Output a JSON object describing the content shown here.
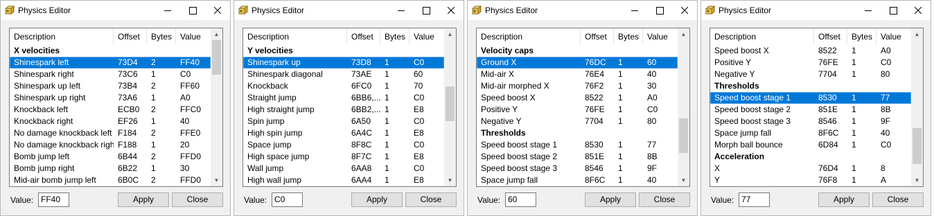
{
  "colors": {
    "selection": "#0078d7",
    "window_bg": "#f0f0f0",
    "list_bg": "#ffffff"
  },
  "windows": [
    {
      "title": "Physics Editor",
      "columns": [
        "Description",
        "Offset",
        "Bytes",
        "Value"
      ],
      "rows": [
        {
          "d": "X velocities",
          "o": "",
          "b": "",
          "v": "",
          "group": true
        },
        {
          "d": "Shinespark left",
          "o": "73D4",
          "b": "2",
          "v": "FF40",
          "selected": true
        },
        {
          "d": "Shinespark right",
          "o": "73C6",
          "b": "1",
          "v": "C0"
        },
        {
          "d": "Shinespark up left",
          "o": "73B4",
          "b": "2",
          "v": "FF60"
        },
        {
          "d": "Shinespark up right",
          "o": "73A6",
          "b": "1",
          "v": "A0"
        },
        {
          "d": "Knockback left",
          "o": "ECB0",
          "b": "2",
          "v": "FFC0"
        },
        {
          "d": "Knockback right",
          "o": "EF26",
          "b": "1",
          "v": "40"
        },
        {
          "d": "No damage knockback left",
          "o": "F184",
          "b": "2",
          "v": "FFE0"
        },
        {
          "d": "No damage knockback right",
          "o": "F188",
          "b": "1",
          "v": "20"
        },
        {
          "d": "Bomb jump left",
          "o": "6B44",
          "b": "2",
          "v": "FFD0"
        },
        {
          "d": "Bomb jump right",
          "o": "6B22",
          "b": "1",
          "v": "30"
        },
        {
          "d": "Mid-air bomb jump left",
          "o": "6B0C",
          "b": "2",
          "v": "FFD0"
        }
      ],
      "value_label": "Value:",
      "value": "FF40",
      "apply_label": "Apply",
      "close_label": "Close"
    },
    {
      "title": "Physics Editor",
      "columns": [
        "Description",
        "Offset",
        "Bytes",
        "Value"
      ],
      "rows": [
        {
          "d": "Y velocities",
          "o": "",
          "b": "",
          "v": "",
          "group": true
        },
        {
          "d": "Shinespark up",
          "o": "73D8",
          "b": "1",
          "v": "C0",
          "selected": true
        },
        {
          "d": "Shinespark diagonal",
          "o": "73AE",
          "b": "1",
          "v": "60"
        },
        {
          "d": "Knockback",
          "o": "6FC0",
          "b": "1",
          "v": "70"
        },
        {
          "d": "Straight jump",
          "o": "6BB6,...",
          "b": "1",
          "v": "C0"
        },
        {
          "d": "High straight jump",
          "o": "6BB2,...",
          "b": "1",
          "v": "E8"
        },
        {
          "d": "Spin jump",
          "o": "6A50",
          "b": "1",
          "v": "C0"
        },
        {
          "d": "High spin jump",
          "o": "6A4C",
          "b": "1",
          "v": "E8"
        },
        {
          "d": "Space jump",
          "o": "8F8C",
          "b": "1",
          "v": "C0"
        },
        {
          "d": "High space jump",
          "o": "8F7C",
          "b": "1",
          "v": "E8"
        },
        {
          "d": "Wall jump",
          "o": "6AA8",
          "b": "1",
          "v": "C0"
        },
        {
          "d": "High wall jump",
          "o": "6AA4",
          "b": "1",
          "v": "E8"
        }
      ],
      "value_label": "Value:",
      "value": "C0",
      "apply_label": "Apply",
      "close_label": "Close"
    },
    {
      "title": "Physics Editor",
      "columns": [
        "Description",
        "Offset",
        "Bytes",
        "Value"
      ],
      "rows": [
        {
          "d": "Velocity caps",
          "o": "",
          "b": "",
          "v": "",
          "group": true
        },
        {
          "d": "Ground X",
          "o": "76DC",
          "b": "1",
          "v": "60",
          "selected": true
        },
        {
          "d": "Mid-air X",
          "o": "76E4",
          "b": "1",
          "v": "40"
        },
        {
          "d": "Mid-air morphed X",
          "o": "76F2",
          "b": "1",
          "v": "30"
        },
        {
          "d": "Speed boost X",
          "o": "8522",
          "b": "1",
          "v": "A0"
        },
        {
          "d": "Positive Y",
          "o": "76FE",
          "b": "1",
          "v": "C0"
        },
        {
          "d": "Negative Y",
          "o": "7704",
          "b": "1",
          "v": "80"
        },
        {
          "d": "Thresholds",
          "o": "",
          "b": "",
          "v": "",
          "group": true
        },
        {
          "d": "Speed boost stage 1",
          "o": "8530",
          "b": "1",
          "v": "77"
        },
        {
          "d": "Speed boost stage 2",
          "o": "851E",
          "b": "1",
          "v": "8B"
        },
        {
          "d": "Speed boost stage 3",
          "o": "8546",
          "b": "1",
          "v": "9F"
        },
        {
          "d": "Space jump fall",
          "o": "8F6C",
          "b": "1",
          "v": "40"
        }
      ],
      "value_label": "Value:",
      "value": "60",
      "apply_label": "Apply",
      "close_label": "Close"
    },
    {
      "title": "Physics Editor",
      "columns": [
        "Description",
        "Offset",
        "Bytes",
        "Value"
      ],
      "rows": [
        {
          "d": "Speed boost X",
          "o": "8522",
          "b": "1",
          "v": "A0"
        },
        {
          "d": "Positive Y",
          "o": "76FE",
          "b": "1",
          "v": "C0"
        },
        {
          "d": "Negative Y",
          "o": "7704",
          "b": "1",
          "v": "80"
        },
        {
          "d": "Thresholds",
          "o": "",
          "b": "",
          "v": "",
          "group": true
        },
        {
          "d": "Speed boost stage 1",
          "o": "8530",
          "b": "1",
          "v": "77",
          "selected": true
        },
        {
          "d": "Speed boost stage 2",
          "o": "851E",
          "b": "1",
          "v": "8B"
        },
        {
          "d": "Speed boost stage 3",
          "o": "8546",
          "b": "1",
          "v": "9F"
        },
        {
          "d": "Space jump fall",
          "o": "8F6C",
          "b": "1",
          "v": "40"
        },
        {
          "d": "Morph ball bounce",
          "o": "6D84",
          "b": "1",
          "v": "C0"
        },
        {
          "d": "Acceleration",
          "o": "",
          "b": "",
          "v": "",
          "group": true
        },
        {
          "d": "X",
          "o": "76D4",
          "b": "1",
          "v": "8"
        },
        {
          "d": "Y",
          "o": "76F8",
          "b": "1",
          "v": "A"
        }
      ],
      "value_label": "Value:",
      "value": "77",
      "apply_label": "Apply",
      "close_label": "Close"
    }
  ]
}
